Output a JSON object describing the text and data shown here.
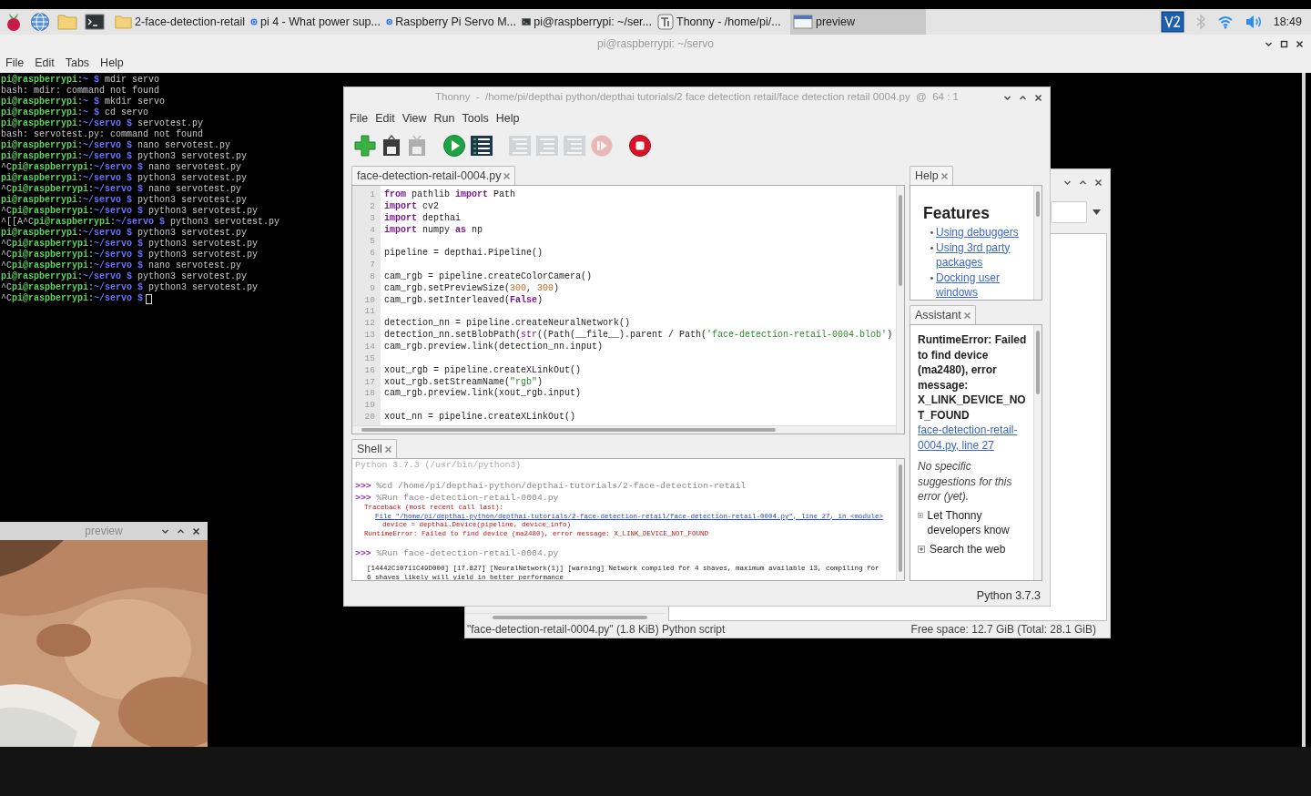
{
  "taskbar": {
    "launchers": [
      {
        "kind": "raspberry"
      },
      {
        "kind": "globe"
      },
      {
        "kind": "folder"
      },
      {
        "kind": "terminal"
      }
    ],
    "tasks": [
      {
        "kind": "folder",
        "label": "2-face-detection-retail",
        "selected": false
      },
      {
        "kind": "browser",
        "label": "pi 4 - What power sup...",
        "selected": false
      },
      {
        "kind": "browser",
        "label": "Raspberry Pi Servo M...",
        "selected": false
      },
      {
        "kind": "terminal",
        "label": "pi@raspberrypi: ~/ser...",
        "selected": false
      },
      {
        "kind": "thonny",
        "label": "Thonny  -  /home/pi/...",
        "selected": false
      },
      {
        "kind": "window",
        "label": "preview",
        "selected": true
      }
    ],
    "tray": [
      {
        "kind": "vnc"
      },
      {
        "kind": "bluetooth"
      },
      {
        "kind": "wifi"
      },
      {
        "kind": "volume"
      }
    ],
    "clock": "18:49"
  },
  "terminal_window": {
    "title": "pi@raspberrypi: ~/servo",
    "menu": [
      "File",
      "Edit",
      "Tabs",
      "Help"
    ],
    "cursor": true,
    "lines": [
      {
        "segments": [
          {
            "text": "pi@raspberrypi",
            "kind": "user"
          },
          {
            "text": ":",
            "kind": "text"
          },
          {
            "text": "~ $",
            "kind": "path"
          },
          {
            "text": " mdir servo",
            "kind": "text"
          }
        ]
      },
      {
        "segments": [
          {
            "text": "bash: mdir: command not found",
            "kind": "text"
          }
        ]
      },
      {
        "segments": [
          {
            "text": "pi@raspberrypi",
            "kind": "user"
          },
          {
            "text": ":",
            "kind": "text"
          },
          {
            "text": "~ $",
            "kind": "path"
          },
          {
            "text": " mkdir servo",
            "kind": "text"
          }
        ]
      },
      {
        "segments": [
          {
            "text": "pi@raspberrypi",
            "kind": "user"
          },
          {
            "text": ":",
            "kind": "text"
          },
          {
            "text": "~ $",
            "kind": "path"
          },
          {
            "text": " cd servo",
            "kind": "text"
          }
        ]
      },
      {
        "segments": [
          {
            "text": "pi@raspberrypi",
            "kind": "user"
          },
          {
            "text": ":",
            "kind": "text"
          },
          {
            "text": "~/servo $",
            "kind": "path"
          },
          {
            "text": " servotest.py",
            "kind": "text"
          }
        ]
      },
      {
        "segments": [
          {
            "text": "bash: servotest.py: command not found",
            "kind": "text"
          }
        ]
      },
      {
        "segments": [
          {
            "text": "pi@raspberrypi",
            "kind": "user"
          },
          {
            "text": ":",
            "kind": "text"
          },
          {
            "text": "~/servo $",
            "kind": "path"
          },
          {
            "text": " nano servotest.py",
            "kind": "text"
          }
        ]
      },
      {
        "segments": [
          {
            "text": "pi@raspberrypi",
            "kind": "user"
          },
          {
            "text": ":",
            "kind": "text"
          },
          {
            "text": "~/servo $",
            "kind": "path"
          },
          {
            "text": " python3 servotest.py",
            "kind": "text"
          }
        ]
      },
      {
        "segments": [
          {
            "text": "^C",
            "kind": "text"
          },
          {
            "text": "pi@raspberrypi",
            "kind": "user"
          },
          {
            "text": ":",
            "kind": "text"
          },
          {
            "text": "~/servo $",
            "kind": "path"
          },
          {
            "text": " nano servotest.py",
            "kind": "text"
          }
        ]
      },
      {
        "segments": [
          {
            "text": "pi@raspberrypi",
            "kind": "user"
          },
          {
            "text": ":",
            "kind": "text"
          },
          {
            "text": "~/servo $",
            "kind": "path"
          },
          {
            "text": " python3 servotest.py",
            "kind": "text"
          }
        ]
      },
      {
        "segments": [
          {
            "text": "^C",
            "kind": "text"
          },
          {
            "text": "pi@raspberrypi",
            "kind": "user"
          },
          {
            "text": ":",
            "kind": "text"
          },
          {
            "text": "~/servo $",
            "kind": "path"
          },
          {
            "text": " nano servotest.py",
            "kind": "text"
          }
        ]
      },
      {
        "segments": [
          {
            "text": "pi@raspberrypi",
            "kind": "user"
          },
          {
            "text": ":",
            "kind": "text"
          },
          {
            "text": "~/servo $",
            "kind": "path"
          },
          {
            "text": " python3 servotest.py",
            "kind": "text"
          }
        ]
      },
      {
        "segments": [
          {
            "text": "^C",
            "kind": "text"
          },
          {
            "text": "pi@raspberrypi",
            "kind": "user"
          },
          {
            "text": ":",
            "kind": "text"
          },
          {
            "text": "~/servo $",
            "kind": "path"
          },
          {
            "text": " python3 servotest.py",
            "kind": "text"
          }
        ]
      },
      {
        "segments": [
          {
            "text": "^[[A^C",
            "kind": "text"
          },
          {
            "text": "pi@raspberrypi",
            "kind": "user"
          },
          {
            "text": ":",
            "kind": "text"
          },
          {
            "text": "~/servo $",
            "kind": "path"
          },
          {
            "text": " python3 servotest.py",
            "kind": "text"
          }
        ]
      },
      {
        "segments": [
          {
            "text": "pi@raspberrypi",
            "kind": "user"
          },
          {
            "text": ":",
            "kind": "text"
          },
          {
            "text": "~/servo $",
            "kind": "path"
          },
          {
            "text": " python3 servotest.py",
            "kind": "text"
          }
        ]
      },
      {
        "segments": [
          {
            "text": "^C",
            "kind": "text"
          },
          {
            "text": "pi@raspberrypi",
            "kind": "user"
          },
          {
            "text": ":",
            "kind": "text"
          },
          {
            "text": "~/servo $",
            "kind": "path"
          },
          {
            "text": " python3 servotest.py",
            "kind": "text"
          }
        ]
      },
      {
        "segments": [
          {
            "text": "^C",
            "kind": "text"
          },
          {
            "text": "pi@raspberrypi",
            "kind": "user"
          },
          {
            "text": ":",
            "kind": "text"
          },
          {
            "text": "~/servo $",
            "kind": "path"
          },
          {
            "text": " python3 servotest.py",
            "kind": "text"
          }
        ]
      },
      {
        "segments": [
          {
            "text": "^C",
            "kind": "text"
          },
          {
            "text": "pi@raspberrypi",
            "kind": "user"
          },
          {
            "text": ":",
            "kind": "text"
          },
          {
            "text": "~/servo $",
            "kind": "path"
          },
          {
            "text": " nano servotest.py",
            "kind": "text"
          }
        ]
      },
      {
        "segments": [
          {
            "text": "pi@raspberrypi",
            "kind": "user"
          },
          {
            "text": ":",
            "kind": "text"
          },
          {
            "text": "~/servo $",
            "kind": "path"
          },
          {
            "text": " python3 servotest.py",
            "kind": "text"
          }
        ]
      },
      {
        "segments": [
          {
            "text": "^C",
            "kind": "text"
          },
          {
            "text": "pi@raspberrypi",
            "kind": "user"
          },
          {
            "text": ":",
            "kind": "text"
          },
          {
            "text": "~/servo $",
            "kind": "path"
          },
          {
            "text": " python3 servotest.py",
            "kind": "text"
          }
        ]
      },
      {
        "segments": [
          {
            "text": "^C",
            "kind": "text"
          },
          {
            "text": "pi@raspberrypi",
            "kind": "user"
          },
          {
            "text": ":",
            "kind": "text"
          },
          {
            "text": "~/servo $",
            "kind": "path"
          }
        ]
      }
    ]
  },
  "file_manager": {
    "status_left": "\"face-detection-retail-0004.py\" (1.8 KiB) Python script",
    "status_right": "Free space: 12.7 GiB (Total: 28.1 GiB)"
  },
  "thonny": {
    "title": "Thonny  -  /home/pi/depthai python/depthai tutorials/2 face detection retail/face detection retail 0004.py  @  64 : 1",
    "menu": [
      "File",
      "Edit",
      "View",
      "Run",
      "Tools",
      "Help"
    ],
    "toolbar": [
      {
        "kind": "new",
        "disabled": false
      },
      {
        "kind": "load",
        "disabled": false
      },
      {
        "kind": "save",
        "disabled": true
      },
      {
        "kind": "run",
        "disabled": false
      },
      {
        "kind": "debug",
        "disabled": false
      },
      {
        "kind": "step",
        "disabled": true
      },
      {
        "kind": "step",
        "disabled": true
      },
      {
        "kind": "step",
        "disabled": true
      },
      {
        "kind": "resume",
        "disabled": true
      },
      {
        "kind": "stop",
        "disabled": false
      }
    ],
    "editor": {
      "tab": "face-detection-retail-0004.py",
      "lines": [
        {
          "number": "1",
          "segments": [
            {
              "text": "from",
              "kind": "keyword"
            },
            {
              "text": " pathlib ",
              "kind": "plain"
            },
            {
              "text": "import",
              "kind": "keyword"
            },
            {
              "text": " Path",
              "kind": "plain"
            }
          ]
        },
        {
          "number": "2",
          "segments": [
            {
              "text": "import",
              "kind": "keyword"
            },
            {
              "text": " cv2",
              "kind": "plain"
            }
          ]
        },
        {
          "number": "3",
          "segments": [
            {
              "text": "import",
              "kind": "keyword"
            },
            {
              "text": " depthai",
              "kind": "plain"
            }
          ]
        },
        {
          "number": "4",
          "segments": [
            {
              "text": "import",
              "kind": "keyword"
            },
            {
              "text": " numpy ",
              "kind": "plain"
            },
            {
              "text": "as",
              "kind": "keyword"
            },
            {
              "text": " np",
              "kind": "plain"
            }
          ]
        },
        {
          "number": "5"
        },
        {
          "number": "6",
          "segments": [
            {
              "text": "pipeline = depthai.Pipeline()",
              "kind": "plain"
            }
          ]
        },
        {
          "number": "7"
        },
        {
          "number": "8",
          "segments": [
            {
              "text": "cam_rgb = pipeline.createColorCamera()",
              "kind": "plain"
            }
          ]
        },
        {
          "number": "9",
          "segments": [
            {
              "text": "cam_rgb.setPreviewSize(",
              "kind": "plain"
            },
            {
              "text": "300",
              "kind": "number"
            },
            {
              "text": ", ",
              "kind": "plain"
            },
            {
              "text": "300",
              "kind": "number"
            },
            {
              "text": ")",
              "kind": "plain"
            }
          ]
        },
        {
          "number": "10",
          "segments": [
            {
              "text": "cam_rgb.setInterleaved(",
              "kind": "plain"
            },
            {
              "text": "False",
              "kind": "keyword"
            },
            {
              "text": ")",
              "kind": "plain"
            }
          ]
        },
        {
          "number": "11"
        },
        {
          "number": "12",
          "segments": [
            {
              "text": "detection_nn = pipeline.createNeuralNetwork()",
              "kind": "plain"
            }
          ]
        },
        {
          "number": "13",
          "segments": [
            {
              "text": "detection_nn.setBlobPath(",
              "kind": "plain"
            },
            {
              "text": "str",
              "kind": "builtin"
            },
            {
              "text": "((Path(__file__).parent / Path(",
              "kind": "plain"
            },
            {
              "text": "'face-detection-retail-0004.blob'",
              "kind": "string"
            },
            {
              "text": ")",
              "kind": "plain"
            }
          ]
        },
        {
          "number": "14",
          "segments": [
            {
              "text": "cam_rgb.preview.link(detection_nn.input)",
              "kind": "plain"
            }
          ]
        },
        {
          "number": "15"
        },
        {
          "number": "16",
          "segments": [
            {
              "text": "xout_rgb = pipeline.createXLinkOut()",
              "kind": "plain"
            }
          ]
        },
        {
          "number": "17",
          "segments": [
            {
              "text": "xout_rgb.setStreamName(",
              "kind": "plain"
            },
            {
              "text": "\"rgb\"",
              "kind": "string"
            },
            {
              "text": ")",
              "kind": "plain"
            }
          ]
        },
        {
          "number": "18",
          "segments": [
            {
              "text": "cam_rgb.preview.link(xout_rgb.input)",
              "kind": "plain"
            }
          ]
        },
        {
          "number": "19"
        },
        {
          "number": "20",
          "segments": [
            {
              "text": "xout_nn = pipeline.createXLinkOut()",
              "kind": "plain"
            }
          ]
        }
      ]
    },
    "shell": {
      "tab": "Shell",
      "lines": [
        {
          "kind": "banner",
          "text": "Python 3.7.3 (/usr/bin/python3)"
        },
        {
          "kind": "command",
          "prompt": ">>>",
          "text": "%cd /home/pi/depthai-python/depthai-tutorials/2-face-detection-retail"
        },
        {
          "kind": "command",
          "prompt": ">>>",
          "text": "%Run face-detection-retail-0004.py"
        },
        {
          "kind": "error",
          "text": "Traceback (most recent call last):"
        },
        {
          "kind": "link",
          "text": "File \"/home/pi/depthai-python/depthai-tutorials/2-face-detection-retail/face-detection-retail-0004.py\", line 27, in <module>"
        },
        {
          "kind": "code",
          "text": "device = depthai.Device(pipeline, device_info)"
        },
        {
          "kind": "error",
          "text": "RuntimeError: Failed to find device (ma2480), error message: X_LINK_DEVICE_NOT_FOUND"
        },
        {
          "kind": "command",
          "prompt": ">>>",
          "text": "%Run face-detection-retail-0004.py"
        },
        {
          "kind": "output",
          "text": "[14442C10711C49D000] [17.827] [NeuralNetwork(1)] [warning] Network compiled for 4 shaves, maximum available 13, compiling for 6 shaves likely will yield in better performance"
        }
      ]
    },
    "help": {
      "tab": "Help",
      "heading": "Features",
      "links": [
        "Using debuggers",
        "Using 3rd party packages",
        "Docking user windows"
      ]
    },
    "assistant": {
      "tab": "Assistant",
      "error": "RuntimeError: Failed to find device (ma2480), error message: X_LINK_DEVICE_NOT_FOUND",
      "link": "face-detection-retail-0004.py, line 27",
      "note": "No specific suggestions for this error (yet).",
      "actions": [
        {
          "label": "Let Thonny developers know",
          "expanded": false
        },
        {
          "label": "Search the web",
          "expanded": false
        }
      ]
    },
    "status": "Python 3.7.3"
  },
  "preview_window": {
    "title": "preview"
  }
}
